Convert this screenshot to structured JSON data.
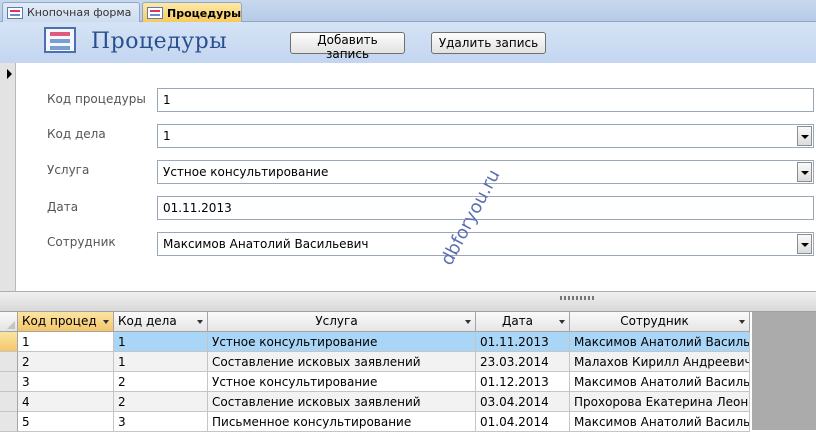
{
  "tabs": [
    {
      "label": "Кнопочная форма",
      "active": false
    },
    {
      "label": "Процедуры",
      "active": true
    }
  ],
  "header": {
    "title": "Процедуры",
    "add_button": "Добавить запись",
    "delete_button": "Удалить запись"
  },
  "form": {
    "fields": [
      {
        "label": "Код процедуры",
        "value": "1",
        "combo": false
      },
      {
        "label": "Код дела",
        "value": "1",
        "combo": true
      },
      {
        "label": "Услуга",
        "value": "Устное консультирование",
        "combo": true
      },
      {
        "label": "Дата",
        "value": "01.11.2013",
        "combo": false
      },
      {
        "label": "Сотрудник",
        "value": "Максимов Анатолий Васильевич",
        "combo": true
      }
    ]
  },
  "watermark": "dbforyou.ru",
  "datasheet": {
    "columns": [
      "Код процед",
      "Код дела",
      "Услуга",
      "Дата",
      "Сотрудник"
    ],
    "rows": [
      [
        "1",
        "1",
        "Устное консультирование",
        "01.11.2013",
        "Максимов Анатолий Васильевич"
      ],
      [
        "2",
        "1",
        "Составление исковых заявлений",
        "23.03.2014",
        "Малахов Кирилл Андреевич"
      ],
      [
        "3",
        "2",
        "Устное консультирование",
        "01.12.2013",
        "Максимов Анатолий Васильевич"
      ],
      [
        "4",
        "2",
        "Составление исковых заявлений",
        "03.04.2014",
        "Прохорова Екатерина Леонидовна"
      ],
      [
        "5",
        "3",
        "Письменное консультирование",
        "01.04.2014",
        "Максимов Анатолий Васильевич"
      ]
    ]
  }
}
